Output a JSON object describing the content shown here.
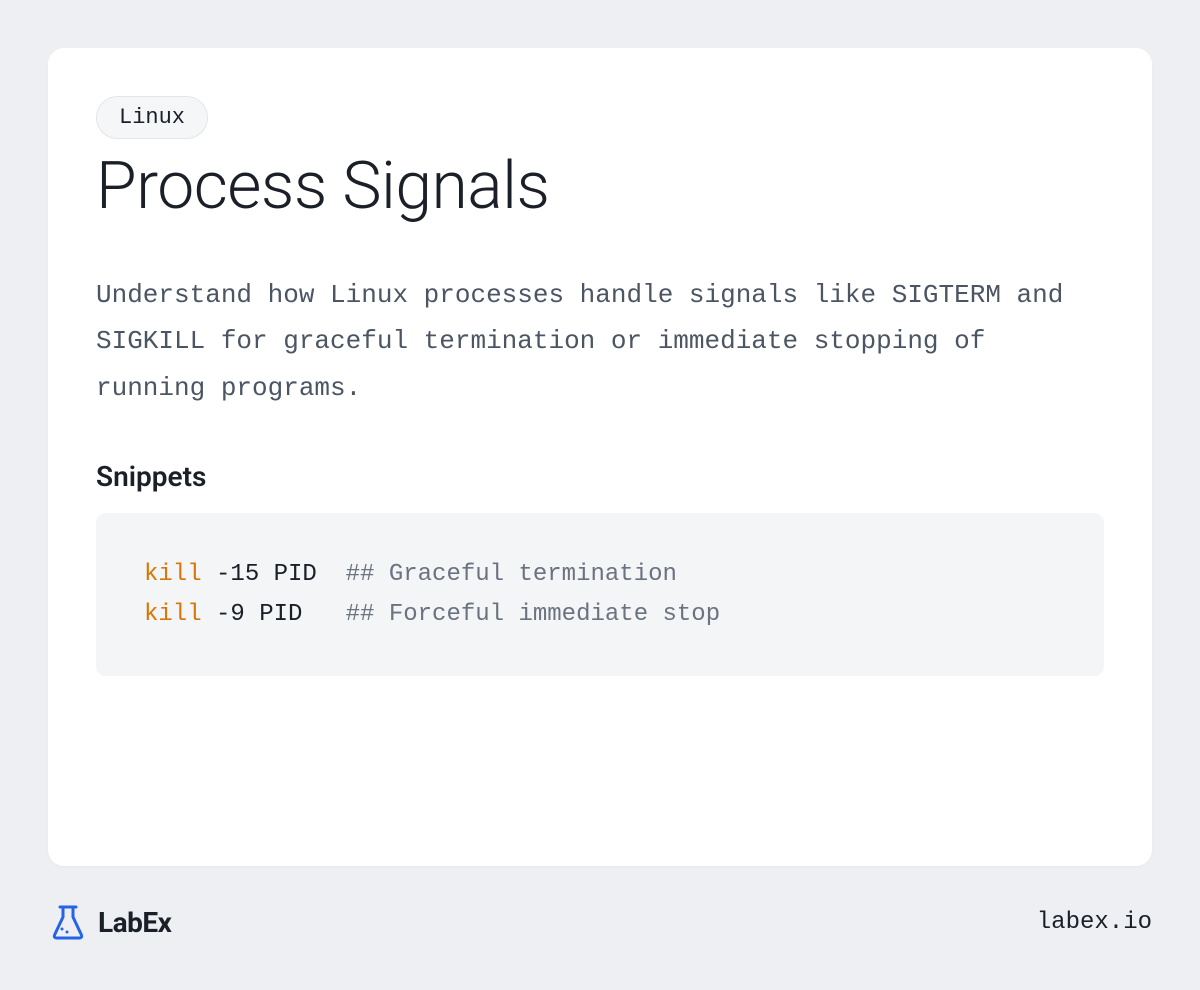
{
  "tag": "Linux",
  "title": "Process Signals",
  "description": "Understand how Linux processes handle signals like SIGTERM and SIGKILL for graceful termination or immediate stopping of running programs.",
  "snippets_heading": "Snippets",
  "code": {
    "lines": [
      {
        "keyword": "kill",
        "args": " -15 PID  ",
        "comment": "## Graceful termination"
      },
      {
        "keyword": "kill",
        "args": " -9 PID   ",
        "comment": "## Forceful immediate stop"
      }
    ]
  },
  "footer": {
    "brand": "LabEx",
    "url": "labex.io"
  },
  "colors": {
    "page_bg": "#edeff2",
    "card_bg": "#ffffff",
    "tag_bg": "#f5f6f8",
    "tag_border": "#e2e5e9",
    "text_primary": "#1a1f28",
    "text_muted": "#4b5563",
    "code_bg": "#f4f5f7",
    "code_keyword": "#d97706",
    "code_comment": "#6b7280",
    "logo_accent": "#2563eb"
  }
}
